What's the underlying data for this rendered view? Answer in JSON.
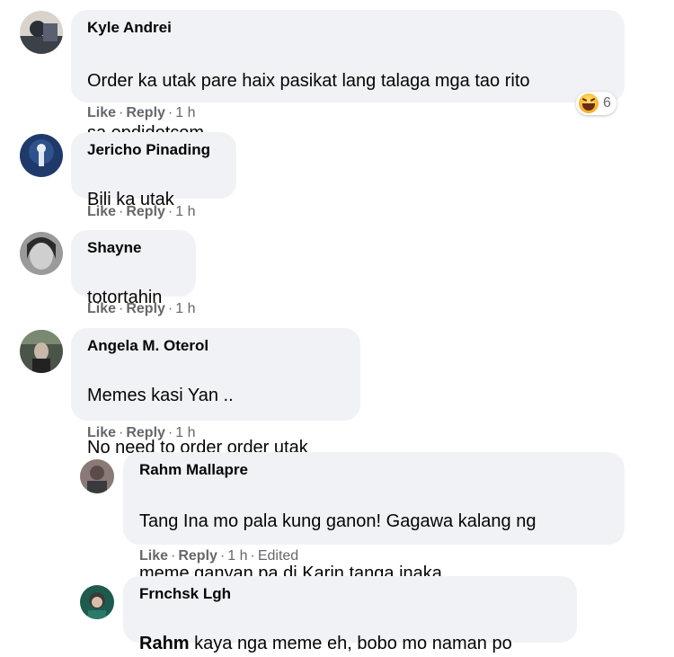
{
  "comments": [
    {
      "author": "Kyle Andrei",
      "lines": [
        "Order ka utak pare haix pasikat lang talaga mga tao rito",
        "sa epdidotcom"
      ],
      "like_label": "Like",
      "reply_label": "Reply",
      "time": "1 h",
      "reaction": {
        "type": "haha",
        "count": "6"
      },
      "avatar_color": "#4a5058"
    },
    {
      "author": "Jericho Pinading",
      "lines": [
        "Bili ka utak"
      ],
      "like_label": "Like",
      "reply_label": "Reply",
      "time": "1 h",
      "avatar_color": "#2d4a7a"
    },
    {
      "author": "Shayne",
      "lines": [
        "totortahin"
      ],
      "like_label": "Like",
      "reply_label": "Reply",
      "time": "1 h",
      "avatar_color": "#5a5a5a"
    },
    {
      "author": "Angela M. Oterol",
      "lines": [
        "Memes kasi Yan ..",
        "No need to order order utak"
      ],
      "like_label": "Like",
      "reply_label": "Reply",
      "time": "1 h",
      "avatar_color": "#3a4438"
    },
    {
      "author": "Rahm Mallapre",
      "lines": [
        "Tang Ina mo pala kung ganon! Gagawa kalang ng",
        "meme ganyan pa di Karin tanga inaka"
      ],
      "like_label": "Like",
      "reply_label": "Reply",
      "time": "1 h",
      "edited": "Edited",
      "avatar_color": "#6a5a58"
    },
    {
      "author": "Frnchsk Lgh",
      "mention": "Rahm",
      "text_after_mention": " kaya nga meme eh, bobo mo naman po",
      "avatar_color": "#2a6a5a"
    }
  ],
  "colors": {
    "bubble_bg": "#f0f2f5",
    "meta_text": "#65676b",
    "name_text": "#050505"
  }
}
